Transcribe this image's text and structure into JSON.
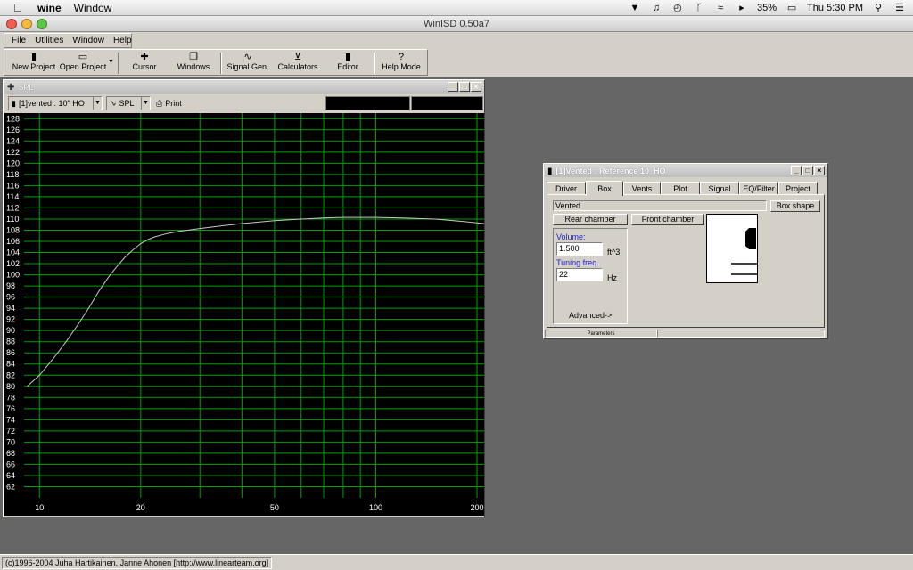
{
  "mac_menubar": {
    "app_name": "wine",
    "items": [
      "Window"
    ],
    "battery": "35%",
    "clock": "Thu 5:30 PM"
  },
  "window": {
    "title": "WinISD 0.50a7"
  },
  "app_menu": {
    "items": [
      {
        "label": "File"
      },
      {
        "label": "Utilities"
      },
      {
        "label": "Window"
      },
      {
        "label": "Help"
      }
    ]
  },
  "toolbar": {
    "buttons": [
      {
        "label": "New Project",
        "icon": "new-project-icon"
      },
      {
        "label": "Open Project",
        "icon": "open-project-icon"
      },
      {
        "label": "Cursor",
        "icon": "cursor-icon"
      },
      {
        "label": "Windows",
        "icon": "windows-icon"
      },
      {
        "label": "Signal Gen.",
        "icon": "signal-gen-icon"
      },
      {
        "label": "Calculators",
        "icon": "calculators-icon"
      },
      {
        "label": "Editor",
        "icon": "editor-icon"
      },
      {
        "label": "Help Mode",
        "icon": "help-mode-icon"
      }
    ]
  },
  "spl_window": {
    "title": "SPL",
    "project_select": "[1]vented : 10\" HO",
    "plot_select": "SPL",
    "print_label": "Print"
  },
  "chart_data": {
    "type": "line",
    "x_scale": "log",
    "xlim": [
      9,
      210
    ],
    "ylim": [
      60,
      129
    ],
    "y_ticks": [
      62,
      64,
      66,
      68,
      70,
      72,
      74,
      76,
      78,
      80,
      82,
      84,
      86,
      88,
      90,
      92,
      94,
      96,
      98,
      100,
      102,
      104,
      106,
      108,
      110,
      112,
      114,
      116,
      118,
      120,
      122,
      124,
      126,
      128
    ],
    "x_tick_labels": [
      10,
      20,
      50,
      100,
      200
    ],
    "grid": true,
    "colors": {
      "background": "#000000",
      "grid": "#00a000",
      "line": "#c8c8c8"
    },
    "series": [
      {
        "x": [
          9.2,
          10,
          11,
          12,
          13,
          14,
          15,
          16,
          17,
          18,
          19,
          20,
          21,
          22,
          24,
          26,
          30,
          35,
          40,
          50,
          60,
          70,
          80,
          90,
          100,
          120,
          150,
          180,
          210
        ],
        "y": [
          80,
          82,
          85,
          88,
          91,
          94,
          97,
          99.5,
          101.5,
          103.2,
          104.5,
          105.6,
          106.3,
          106.8,
          107.4,
          107.8,
          108.3,
          108.8,
          109.2,
          109.7,
          110,
          110.2,
          110.3,
          110.3,
          110.3,
          110.2,
          110,
          109.6,
          109.2
        ]
      }
    ]
  },
  "vented_window": {
    "title": "[1]Vented : Reference 10_HO",
    "tabs": [
      "Driver",
      "Box",
      "Vents",
      "Plot",
      "Signal",
      "EQ/Filter",
      "Project"
    ],
    "active_tab": "Box",
    "box_type": "Vented",
    "box_shape_label": "Box shape",
    "rear_chamber_label": "Rear chamber",
    "front_chamber_label": "Front chamber",
    "volume_label": "Volume:",
    "volume_value": "1.500",
    "volume_unit": "ft^3",
    "tuning_label": "Tuning freq.",
    "tuning_value": "22",
    "tuning_unit": "Hz",
    "advanced_label": "Advanced->",
    "status_label": "Parameters"
  },
  "app_status": {
    "copyright": "(c)1996-2004 Juha Hartikainen, Janne Ahonen [http://www.linearteam.org]"
  }
}
